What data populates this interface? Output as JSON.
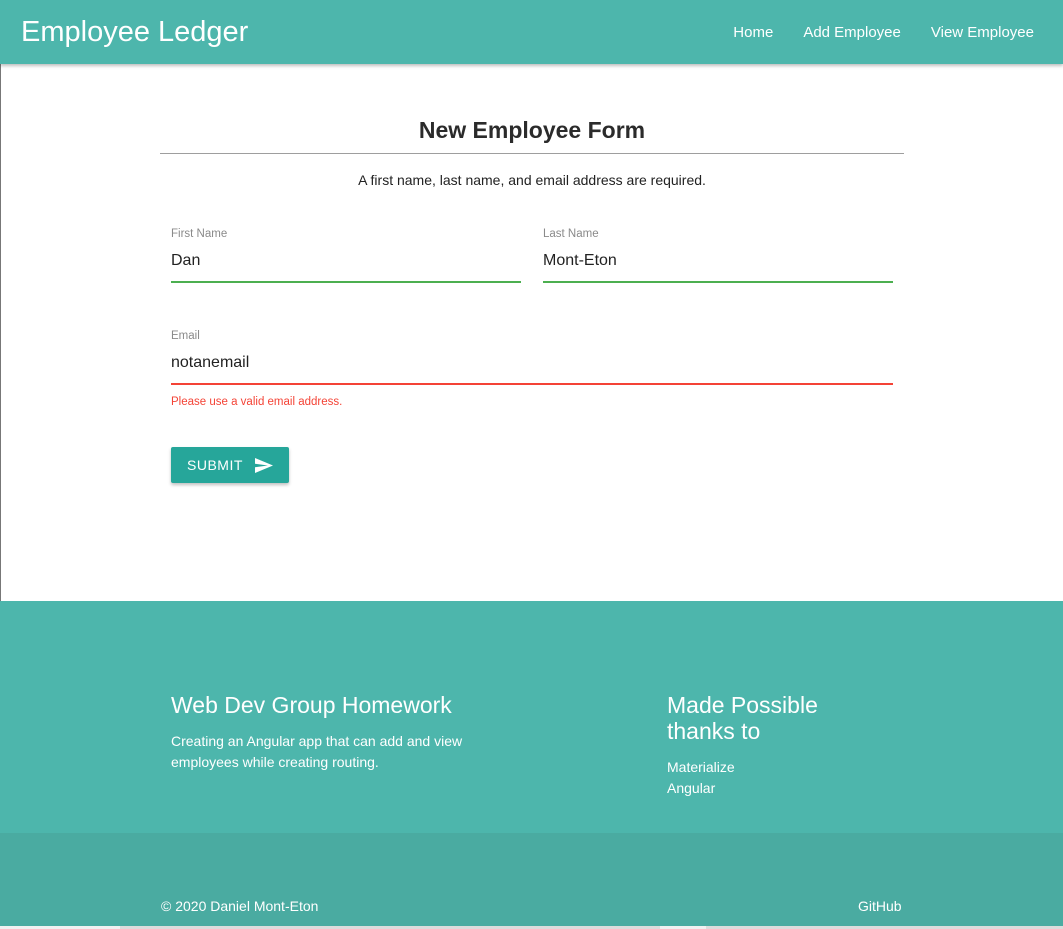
{
  "navbar": {
    "brand": "Employee Ledger",
    "links": [
      "Home",
      "Add Employee",
      "View Employee"
    ]
  },
  "form": {
    "title": "New Employee Form",
    "note": "A first name, last name, and email address are required.",
    "first_name": {
      "label": "First Name",
      "value": "Dan"
    },
    "last_name": {
      "label": "Last Name",
      "value": "Mont-Eton"
    },
    "email": {
      "label": "Email",
      "value": "notanemail",
      "error": "Please use a valid email address."
    },
    "submit_label": "SUBMIT",
    "submit_icon": "send-icon"
  },
  "footer": {
    "left_heading": "Web Dev Group Homework",
    "left_text_line1": "Creating an Angular app that can add and view",
    "left_text_line2": "employees while creating routing.",
    "right_heading_line1": "Made Possible",
    "right_heading_line2": "thanks to",
    "links": [
      "Materialize",
      "Angular"
    ],
    "copyright": "© 2020 Daniel Mont-Eton",
    "github": "GitHub"
  },
  "colors": {
    "primary": "#4db6ac",
    "button": "#26a69a",
    "valid": "#4caf50",
    "invalid": "#f44336"
  }
}
